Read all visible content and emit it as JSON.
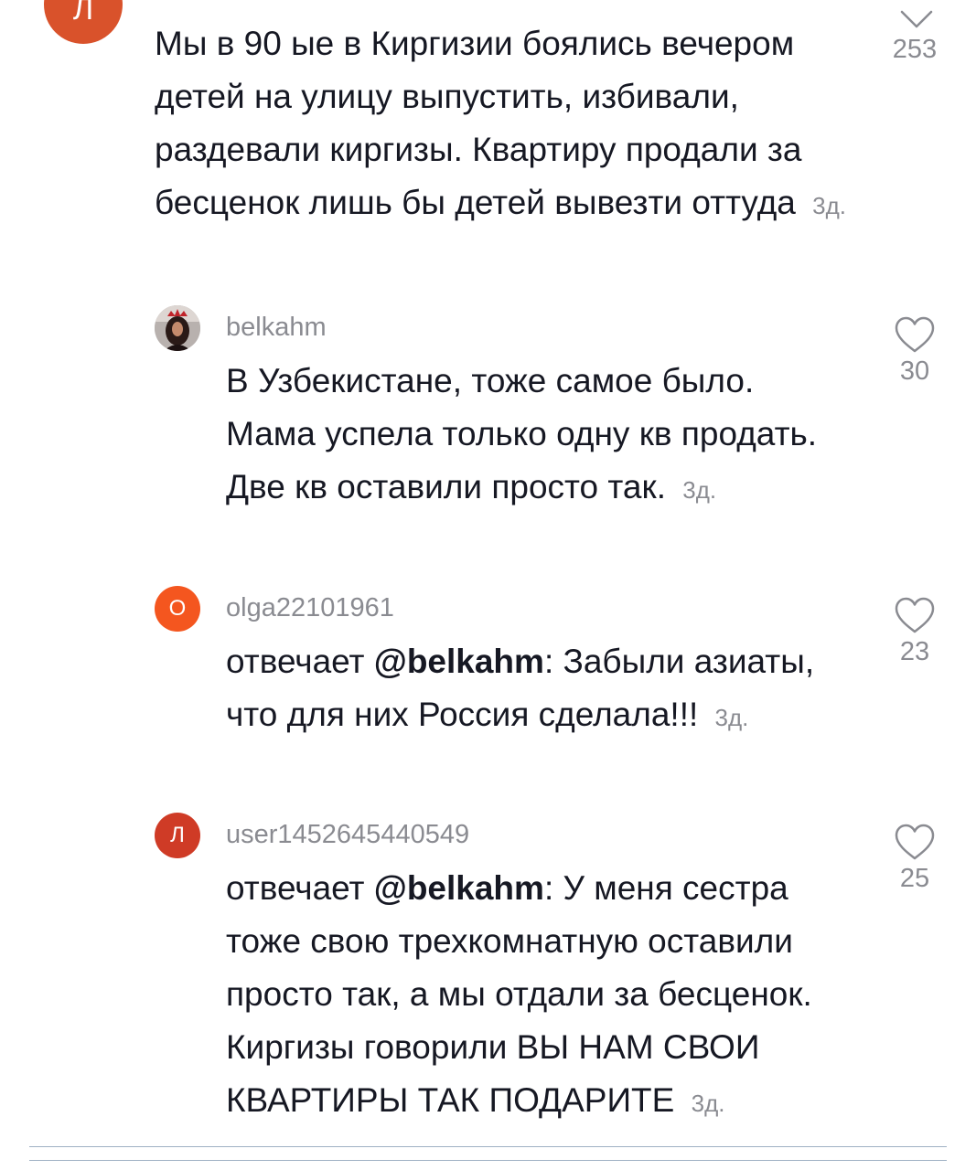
{
  "comments": [
    {
      "avatar_letter": "Л",
      "text": "Мы в 90 ые в Киргизии боялись вечером детей на улицу выпустить, избивали, раздевали киргизы. Квартиру продали за бесценок лишь бы детей вывезти оттуда",
      "time": "3д.",
      "likes": "253",
      "like_icon": "chevron-down-icon"
    },
    {
      "username": "belkahm",
      "avatar": "profile-photo",
      "text": "В Узбекистане, тоже самое было. Мама успела только одну кв продать. Две кв оставили просто так.",
      "time": "3д.",
      "likes": "30",
      "like_icon": "heart-outline-icon"
    },
    {
      "username": "olga22101961",
      "avatar_letter": "О",
      "reply_prefix": "отвечает",
      "mention": "@belkahm",
      "text": ": Забыли азиаты, что для них Россия сделала!!!",
      "time": "3д.",
      "likes": "23",
      "like_icon": "heart-outline-icon"
    },
    {
      "username": "user1452645440549",
      "avatar_letter": "Л",
      "reply_prefix": "отвечает",
      "mention": "@belkahm",
      "text": ": У меня сестра тоже свою трехкомнатную оставили просто так, а мы отдали за бесценок. Киргизы говорили ВЫ НАМ СВОИ КВАРТИРЫ ТАК ПОДАРИТЕ",
      "time": "3д.",
      "likes": "25",
      "like_icon": "heart-outline-icon"
    }
  ],
  "colors": {
    "text": "#161823",
    "muted": "#8a8b91",
    "avatar_top": "#d9522b",
    "avatar_olga": "#f4561f",
    "avatar_user": "#cf3b26"
  }
}
